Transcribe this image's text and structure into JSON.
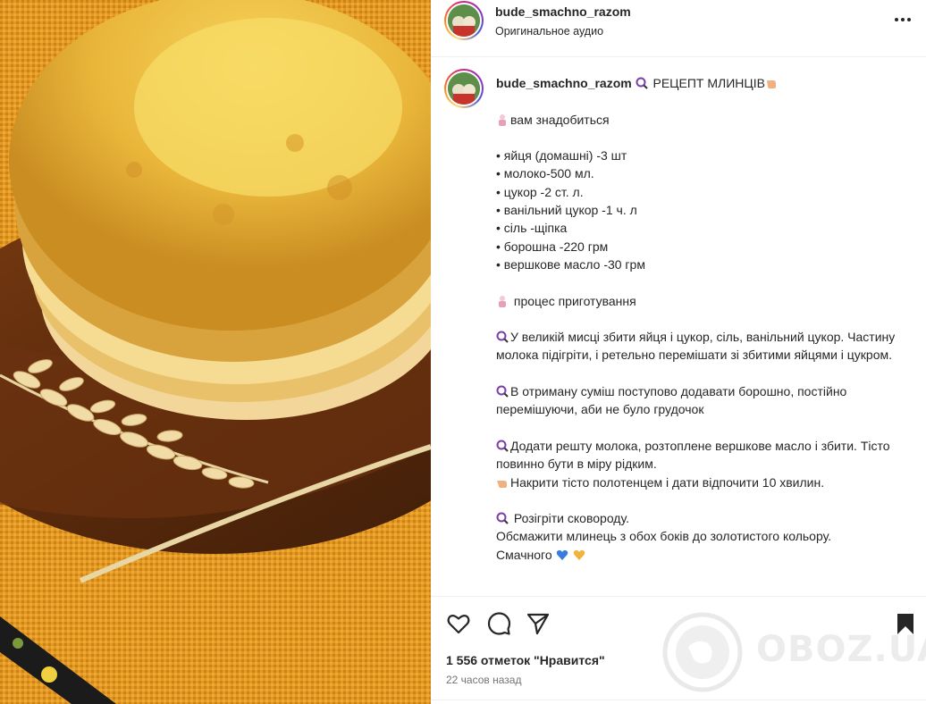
{
  "header": {
    "username": "bude_smachno_razom",
    "audio": "Оригинальное аудио"
  },
  "caption": {
    "username": "bude_smachno_razom",
    "title": "РЕЦЕПТ МЛИНЦІВ",
    "need": "вам знадобиться",
    "ingredients": [
      "• яйця (домашні) -3 шт",
      "• молоко-500 мл.",
      "• цукор -2 ст. л.",
      "• ванільний цукор -1 ч. л",
      "• сіль -щіпка",
      "• борошна -220 грм",
      "• вершкове масло -30 грм"
    ],
    "process": "процес приготування",
    "step1": "У великій мисці збити яйця і цукор, сіль, ванільний цукор. Частину молока підігріти, і ретельно перемішати зі збитими яйцями і цукром.",
    "step2": "В отриману суміш поступово додавати борошно, постійно перемішуючи, аби не було грудочок",
    "step3": "Додати решту молока, розтоплене вершкове масло і збити. Тісто повинно бути в міру рідким.",
    "step4": "Накрити тісто полотенцем і дати відпочити 10 хвилин.",
    "step5": " Розігріти сковороду.",
    "step6": "Обсмажити млинець з обох боків до золотистого кольору.",
    "closing": "Смачного"
  },
  "footer": {
    "likes": "1 556 отметок \"Нравится\"",
    "time": "22 часов назад",
    "watermark": "OBOZ.UA"
  },
  "icons": {
    "heart": "heart-icon",
    "comment": "comment-icon",
    "share": "share-icon",
    "bookmark": "bookmark-icon",
    "more": "more-icon"
  },
  "colors": {
    "text": "#262626",
    "muted": "#737373",
    "border": "#efefef"
  }
}
